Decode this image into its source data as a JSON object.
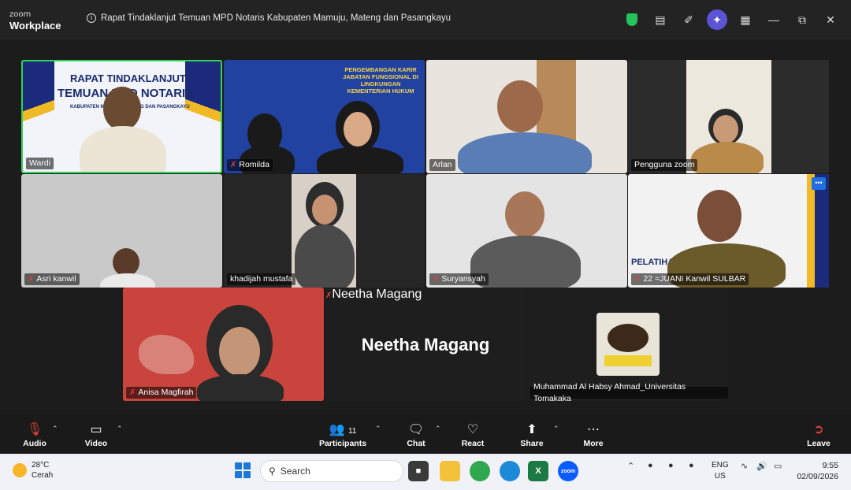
{
  "app": {
    "logo_top": "zoom",
    "logo_bottom": "Workplace"
  },
  "meeting": {
    "title": "Rapat Tindaklanjut Temuan MPD Notaris Kabupaten Mamuju, Mateng dan Pasangkayu"
  },
  "titlebar_icons": [
    "shield-icon",
    "notes-icon",
    "whiteboard-icon",
    "ai-companion-icon",
    "apps-grid-icon",
    "minimize-icon",
    "restore-icon",
    "close-icon"
  ],
  "participants": [
    {
      "name": "Wardi",
      "muted": false,
      "active": true
    },
    {
      "name": "Romilda",
      "muted": true,
      "active": false
    },
    {
      "name": "Arlan",
      "muted": false,
      "active": false
    },
    {
      "name": "Pengguna zoom",
      "muted": false,
      "active": false
    },
    {
      "name": "Asri kanwil",
      "muted": true,
      "active": false
    },
    {
      "name": "khadijah mustafa",
      "muted": false,
      "active": false
    },
    {
      "name": "Suryansyah",
      "muted": true,
      "active": false
    },
    {
      "name": "22 =JUANI Kanwil SULBAR",
      "muted": true,
      "active": false
    },
    {
      "name": "Anisa Magfirah",
      "muted": true,
      "active": false
    },
    {
      "name": "Neetha Magang",
      "muted": true,
      "active": false
    },
    {
      "name": "Muhammad Al Habsy Ahmad_Universitas Tomakaka",
      "muted": false,
      "active": false
    }
  ],
  "slides": {
    "wardi_line1": "RAPAT TINDAKLANJUT",
    "wardi_line2": "TEMUAN MPD NOTARIS",
    "wardi_line3": "KABUPATEN MAMUJU, MATENG DAN PASANGKAYU",
    "romilda_line": "PENGEMBANGAN KARIR JABATAN FUNGSIONAL DI LINGKUNGAN KEMENTERIAN HUKUM",
    "juani_line": "PELATIHA"
  },
  "big_name": "Neetha Magang",
  "toolbar": {
    "audio": "Audio",
    "video": "Video",
    "participants": "Participants",
    "participants_count": "11",
    "chat": "Chat",
    "react": "React",
    "share": "Share",
    "more": "More",
    "leave": "Leave"
  },
  "taskbar": {
    "temperature": "28°C",
    "weather": "Cerah",
    "search_placeholder": "Search",
    "lang_top": "ENG",
    "lang_bottom": "US",
    "time": "9:55",
    "date": "02/09/2026"
  },
  "colors": {
    "active_speaker": "#33d45a",
    "muted": "#e3403b",
    "ai_button": "#5b54d6"
  }
}
